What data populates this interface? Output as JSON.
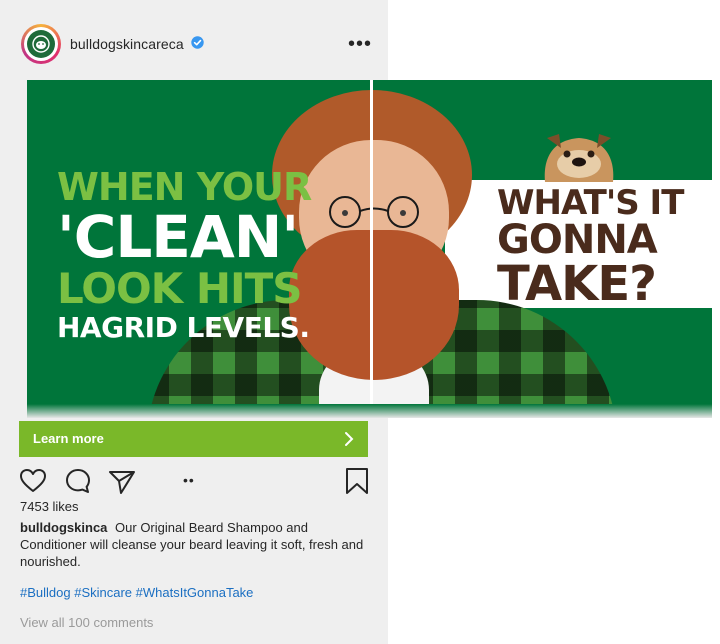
{
  "post": {
    "username": "bulldogskincareca",
    "verified_icon": "verified-badge-icon",
    "more_label": "•••",
    "brand_accent": "#00753a"
  },
  "ad": {
    "headline_left": [
      "WHEN YOUR",
      "'CLEAN'",
      "LOOK HITS",
      "HAGRID LEVELS."
    ],
    "headline_right": [
      "WHAT'S IT",
      "GONNA",
      "TAKE?"
    ],
    "green": "#00753a",
    "lime": "#7bc043",
    "brown": "#4a2b1c"
  },
  "cta": {
    "label": "Learn more",
    "color": "#7ab829"
  },
  "actions": {
    "like_icon": "heart-icon",
    "comment_icon": "comment-icon",
    "share_icon": "send-icon",
    "save_icon": "bookmark-icon",
    "pager": "••"
  },
  "likes": "7453 likes",
  "caption": {
    "user": "bulldogskinca",
    "text": "Our Original Beard Shampoo and Conditioner will cleanse your beard leaving it soft, fresh and nourished."
  },
  "hashtags": "#Bulldog #Skincare #WhatsItGonnaTake",
  "view_comments": "View all 100 comments"
}
